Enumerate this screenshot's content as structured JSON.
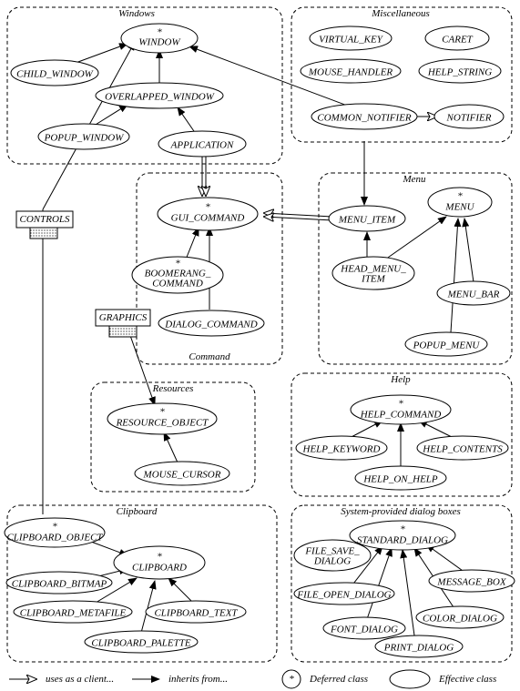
{
  "clusters": {
    "windows": "Windows",
    "misc": "Miscellaneous",
    "menu": "Menu",
    "command": "Command",
    "resources": "Resources",
    "help": "Help",
    "clipboard": "Clipboard",
    "sysdlg": "System-provided dialog boxes"
  },
  "nodes": {
    "window": {
      "label": "WINDOW",
      "deferred": true
    },
    "child_window": {
      "label": "CHILD_WINDOW",
      "deferred": false
    },
    "overlapped_window": {
      "label": "OVERLAPPED_WINDOW",
      "deferred": false
    },
    "popup_window": {
      "label": "POPUP_WINDOW",
      "deferred": false
    },
    "application": {
      "label": "APPLICATION",
      "deferred": false
    },
    "virtual_key": {
      "label": "VIRTUAL_KEY",
      "deferred": false
    },
    "caret": {
      "label": "CARET",
      "deferred": false
    },
    "mouse_handler": {
      "label": "MOUSE_HANDLER",
      "deferred": false
    },
    "help_string": {
      "label": "HELP_STRING",
      "deferred": false
    },
    "common_notifier": {
      "label": "COMMON_NOTIFIER",
      "deferred": false
    },
    "notifier": {
      "label": "NOTIFIER",
      "deferred": false
    },
    "gui_command": {
      "label": "GUI_COMMAND",
      "deferred": true
    },
    "boomerang_command": {
      "label": "BOOMERANG_\nCOMMAND",
      "deferred": true
    },
    "dialog_command": {
      "label": "DIALOG_COMMAND",
      "deferred": false
    },
    "menu_item": {
      "label": "MENU_ITEM",
      "deferred": false
    },
    "menu": {
      "label": "MENU",
      "deferred": true
    },
    "head_menu_item": {
      "label": "HEAD_MENU_\nITEM",
      "deferred": false
    },
    "menu_bar": {
      "label": "MENU_BAR",
      "deferred": false
    },
    "popup_menu": {
      "label": "POPUP_MENU",
      "deferred": false
    },
    "resource_object": {
      "label": "RESOURCE_OBJECT",
      "deferred": true
    },
    "mouse_cursor": {
      "label": "MOUSE_CURSOR",
      "deferred": false
    },
    "help_command": {
      "label": "HELP_COMMAND",
      "deferred": true
    },
    "help_keyword": {
      "label": "HELP_KEYWORD",
      "deferred": false
    },
    "help_contents": {
      "label": "HELP_CONTENTS",
      "deferred": false
    },
    "help_on_help": {
      "label": "HELP_ON_HELP",
      "deferred": false
    },
    "clipboard_object": {
      "label": "CLIPBOARD_OBJECT",
      "deferred": true
    },
    "clipboard": {
      "label": "CLIPBOARD",
      "deferred": true
    },
    "clipboard_bitmap": {
      "label": "CLIPBOARD_BITMAP",
      "deferred": false
    },
    "clipboard_metafile": {
      "label": "CLIPBOARD_METAFILE",
      "deferred": false
    },
    "clipboard_text": {
      "label": "CLIPBOARD_TEXT",
      "deferred": false
    },
    "clipboard_palette": {
      "label": "CLIPBOARD_PALETTE",
      "deferred": false
    },
    "standard_dialog": {
      "label": "STANDARD_DIALOG",
      "deferred": true
    },
    "file_save_dialog": {
      "label": "FILE_SAVE_\nDIALOG",
      "deferred": false
    },
    "file_open_dialog": {
      "label": "FILE_OPEN_DIALOG",
      "deferred": false
    },
    "font_dialog": {
      "label": "FONT_DIALOG",
      "deferred": false
    },
    "print_dialog": {
      "label": "PRINT_DIALOG",
      "deferred": false
    },
    "color_dialog": {
      "label": "COLOR_DIALOG",
      "deferred": false
    },
    "message_box": {
      "label": "MESSAGE_BOX",
      "deferred": false
    }
  },
  "images": {
    "controls": "CONTROLS",
    "graphics": "GRAPHICS"
  },
  "legend": {
    "uses": "uses as a client...",
    "inherits": "inherits from...",
    "deferred": "Deferred class",
    "effective": "Effective class",
    "star": "*"
  },
  "chart_data": {
    "type": "diagram",
    "description": "Class hierarchy / client diagram",
    "edges": [
      {
        "from": "CHILD_WINDOW",
        "to": "WINDOW",
        "kind": "inherits"
      },
      {
        "from": "OVERLAPPED_WINDOW",
        "to": "WINDOW",
        "kind": "inherits"
      },
      {
        "from": "POPUP_WINDOW",
        "to": "OVERLAPPED_WINDOW",
        "kind": "inherits"
      },
      {
        "from": "APPLICATION",
        "to": "OVERLAPPED_WINDOW",
        "kind": "inherits"
      },
      {
        "from": "COMMON_NOTIFIER",
        "to": "WINDOW",
        "kind": "inherits"
      },
      {
        "from": "COMMON_NOTIFIER",
        "to": "NOTIFIER",
        "kind": "uses"
      },
      {
        "from": "APPLICATION",
        "to": "GUI_COMMAND",
        "kind": "uses"
      },
      {
        "from": "BOOMERANG_COMMAND",
        "to": "GUI_COMMAND",
        "kind": "inherits"
      },
      {
        "from": "DIALOG_COMMAND",
        "to": "GUI_COMMAND",
        "kind": "inherits"
      },
      {
        "from": "MENU_ITEM",
        "to": "GUI_COMMAND",
        "kind": "uses"
      },
      {
        "from": "HEAD_MENU_ITEM",
        "to": "MENU_ITEM",
        "kind": "inherits"
      },
      {
        "from": "HEAD_MENU_ITEM",
        "to": "MENU",
        "kind": "inherits"
      },
      {
        "from": "MENU_BAR",
        "to": "MENU",
        "kind": "inherits"
      },
      {
        "from": "POPUP_MENU",
        "to": "MENU",
        "kind": "inherits"
      },
      {
        "from": "COMMON_NOTIFIER",
        "to": "MENU_ITEM",
        "kind": "inherits-down"
      },
      {
        "from": "MOUSE_CURSOR",
        "to": "RESOURCE_OBJECT",
        "kind": "inherits"
      },
      {
        "from": "HELP_KEYWORD",
        "to": "HELP_COMMAND",
        "kind": "inherits"
      },
      {
        "from": "HELP_CONTENTS",
        "to": "HELP_COMMAND",
        "kind": "inherits"
      },
      {
        "from": "HELP_ON_HELP",
        "to": "HELP_COMMAND",
        "kind": "inherits"
      },
      {
        "from": "CLIPBOARD",
        "to": "CLIPBOARD_OBJECT",
        "kind": "uses-or-inherits"
      },
      {
        "from": "CLIPBOARD_BITMAP",
        "to": "CLIPBOARD",
        "kind": "inherits"
      },
      {
        "from": "CLIPBOARD_METAFILE",
        "to": "CLIPBOARD",
        "kind": "inherits"
      },
      {
        "from": "CLIPBOARD_TEXT",
        "to": "CLIPBOARD",
        "kind": "inherits"
      },
      {
        "from": "CLIPBOARD_PALETTE",
        "to": "CLIPBOARD",
        "kind": "inherits"
      },
      {
        "from": "FILE_SAVE_DIALOG",
        "to": "STANDARD_DIALOG",
        "kind": "inherits"
      },
      {
        "from": "FILE_OPEN_DIALOG",
        "to": "STANDARD_DIALOG",
        "kind": "inherits"
      },
      {
        "from": "FONT_DIALOG",
        "to": "STANDARD_DIALOG",
        "kind": "inherits"
      },
      {
        "from": "PRINT_DIALOG",
        "to": "STANDARD_DIALOG",
        "kind": "inherits"
      },
      {
        "from": "COLOR_DIALOG",
        "to": "STANDARD_DIALOG",
        "kind": "inherits"
      },
      {
        "from": "MESSAGE_BOX",
        "to": "STANDARD_DIALOG",
        "kind": "inherits"
      },
      {
        "from": "CONTROLS",
        "to": "WINDOW",
        "kind": "image-link"
      },
      {
        "from": "CONTROLS",
        "to": "CLIPBOARD_OBJECT",
        "kind": "image-link"
      },
      {
        "from": "GRAPHICS",
        "to": "RESOURCE_OBJECT",
        "kind": "image-link"
      }
    ]
  }
}
